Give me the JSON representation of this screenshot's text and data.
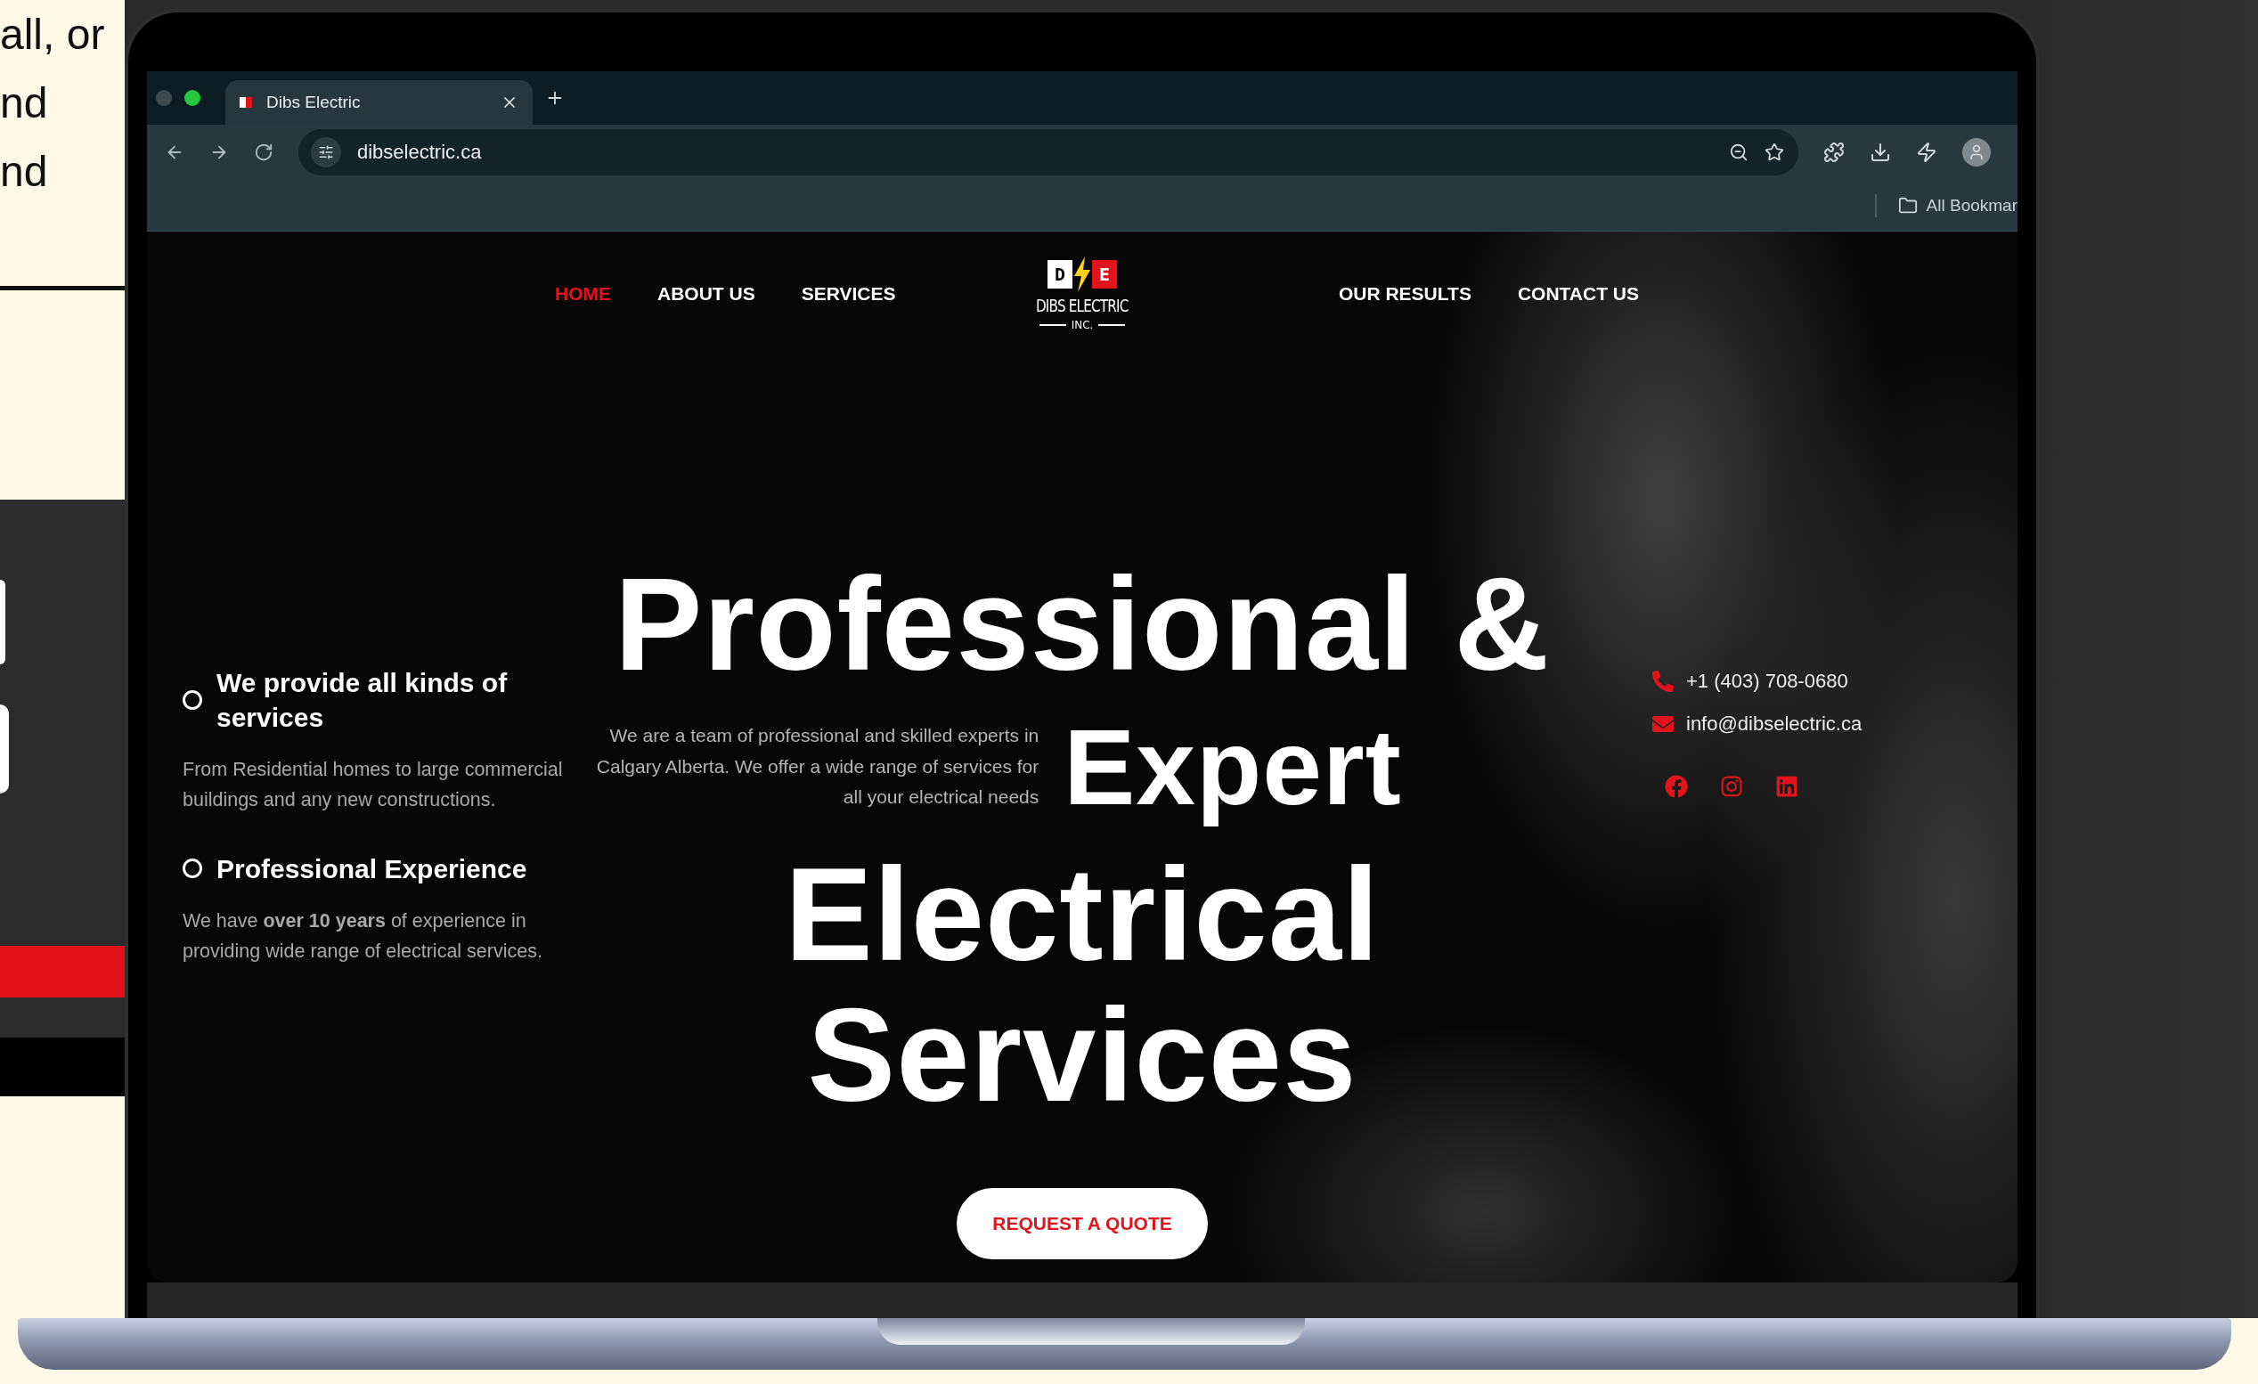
{
  "background_text": [
    "all, or",
    "nd",
    "nd"
  ],
  "browser": {
    "tabs": [
      {
        "title": "Dibs Electric",
        "selected": true
      }
    ],
    "address": "dibselectric.ca",
    "bookmarks": [
      {
        "label": "All Bookmar"
      }
    ]
  },
  "nav": {
    "left": [
      {
        "label": "HOME",
        "selected": true
      },
      {
        "label": "ABOUT US",
        "selected": false
      },
      {
        "label": "SERVICES",
        "selected": false
      }
    ],
    "logo": {
      "letters": [
        "D",
        "E"
      ],
      "name": "DIBS ELECTRIC",
      "sub": "INC."
    },
    "right": [
      {
        "label": "OUR RESULTS",
        "selected": false
      },
      {
        "label": "CONTACT US",
        "selected": false
      }
    ]
  },
  "features": [
    {
      "title": "We provide all kinds of services",
      "text": "From Residential homes to large commercial buildings and any new constructions."
    },
    {
      "title": "Professional Experience",
      "text": "We have **over 10 years** of experience in providing wide range of electrical services."
    }
  ],
  "headline": {
    "line1": "Professional &",
    "intro": "We are a team of professional and skilled experts in Calgary Alberta. We offer a wide range of services for all your electrical needs",
    "line2": "Expert",
    "line3": "Electrical",
    "line4": "Services"
  },
  "contacts": [
    {
      "kind": "phone",
      "text": "+1 (403) 708-0680"
    },
    {
      "kind": "email",
      "text": "info@dibselectric.ca"
    }
  ],
  "social": [
    {
      "kind": "facebook"
    },
    {
      "kind": "instagram"
    },
    {
      "kind": "linkedin"
    }
  ],
  "cta": "REQUEST A QUOTE"
}
